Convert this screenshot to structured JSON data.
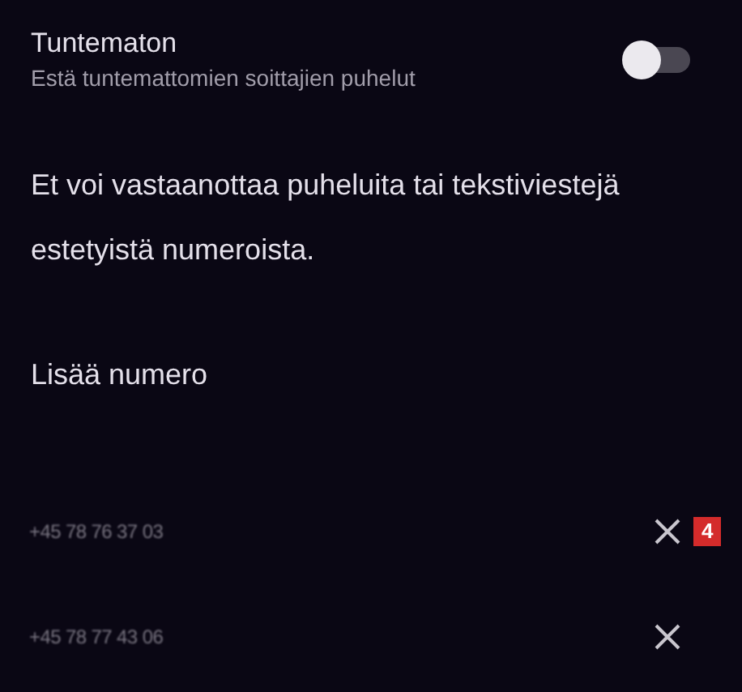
{
  "unknown_setting": {
    "title": "Tuntematon",
    "subtitle": "Estä tuntemattomien soittajien puhelut",
    "on": false
  },
  "info": "Et voi vastaanottaa puheluita tai tekstiviestejä estetyistä numeroista.",
  "add_number": "Lisää numero",
  "blocked_numbers": [
    {
      "number": "+45 78 76 37 03",
      "badge": "4"
    },
    {
      "number": "+45 78 77 43 06"
    }
  ]
}
